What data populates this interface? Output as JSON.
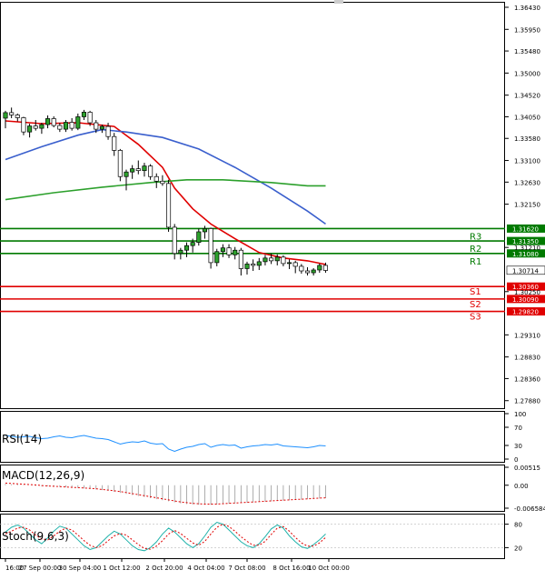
{
  "chart_data": [
    {
      "type": "candlestick",
      "ylim": [
        1.27835,
        1.3643
      ],
      "y_ticks": [
        "1.36430",
        "1.35950",
        "1.35480",
        "1.35000",
        "1.34520",
        "1.34050",
        "1.33580",
        "1.33100",
        "1.32630",
        "1.32150",
        "1.31210",
        "1.30250",
        "1.29310",
        "1.28830",
        "1.28360",
        "1.27880"
      ],
      "x_ticks": [
        "16:00",
        "27 Sep 00:00",
        "30 Sep 04:00",
        "1 Oct 12:00",
        "2 Oct 20:00",
        "4 Oct 04:00",
        "7 Oct 08:00",
        "8 Oct 16:00",
        "10 Oct 00:00"
      ],
      "current_price": {
        "value": 1.30714,
        "label": "1.30714"
      },
      "levels": [
        {
          "name": "R3",
          "value": 1.3162,
          "label": "1.31620",
          "color": "#007a00"
        },
        {
          "name": "R2",
          "value": 1.3135,
          "label": "1.31350",
          "color": "#007a00"
        },
        {
          "name": "R1",
          "value": 1.3108,
          "label": "1.31080",
          "color": "#007a00"
        },
        {
          "name": "S1",
          "value": 1.3036,
          "label": "1.30360",
          "color": "#e00000"
        },
        {
          "name": "S2",
          "value": 1.3009,
          "label": "1.30090",
          "color": "#e00000"
        },
        {
          "name": "S3",
          "value": 1.2982,
          "label": "1.29820",
          "color": "#e00000"
        }
      ],
      "candles": [
        [
          1.3402,
          1.3418,
          1.338,
          1.3414
        ],
        [
          1.3414,
          1.3425,
          1.3402,
          1.3409
        ],
        [
          1.3409,
          1.3412,
          1.3395,
          1.3403
        ],
        [
          1.3403,
          1.3405,
          1.3365,
          1.3372
        ],
        [
          1.3372,
          1.339,
          1.336,
          1.3385
        ],
        [
          1.3385,
          1.3398,
          1.3375,
          1.338
        ],
        [
          1.338,
          1.3392,
          1.3368,
          1.3388
        ],
        [
          1.3388,
          1.3408,
          1.338,
          1.3401
        ],
        [
          1.3401,
          1.3406,
          1.3382,
          1.3386
        ],
        [
          1.3386,
          1.3392,
          1.3372,
          1.3378
        ],
        [
          1.3378,
          1.3398,
          1.3372,
          1.3393
        ],
        [
          1.3393,
          1.3402,
          1.3375,
          1.338
        ],
        [
          1.338,
          1.3412,
          1.3376,
          1.3405
        ],
        [
          1.3405,
          1.342,
          1.3398,
          1.3415
        ],
        [
          1.3415,
          1.3418,
          1.3385,
          1.3392
        ],
        [
          1.3392,
          1.3398,
          1.337,
          1.3378
        ],
        [
          1.3378,
          1.3388,
          1.337,
          1.3384
        ],
        [
          1.3384,
          1.3392,
          1.3355,
          1.3362
        ],
        [
          1.3362,
          1.337,
          1.332,
          1.3332
        ],
        [
          1.3332,
          1.3335,
          1.3265,
          1.3275
        ],
        [
          1.3275,
          1.329,
          1.3245,
          1.3285
        ],
        [
          1.3285,
          1.33,
          1.327,
          1.3292
        ],
        [
          1.3292,
          1.331,
          1.328,
          1.3288
        ],
        [
          1.3288,
          1.3305,
          1.3275,
          1.3298
        ],
        [
          1.3298,
          1.3302,
          1.3268,
          1.3275
        ],
        [
          1.3275,
          1.3282,
          1.325,
          1.3265
        ],
        [
          1.3265,
          1.3278,
          1.3255,
          1.326
        ],
        [
          1.326,
          1.3268,
          1.3155,
          1.3165
        ],
        [
          1.3165,
          1.3172,
          1.3095,
          1.3108
        ],
        [
          1.3108,
          1.312,
          1.3095,
          1.3115
        ],
        [
          1.3115,
          1.3132,
          1.31,
          1.3125
        ],
        [
          1.3125,
          1.314,
          1.311,
          1.3132
        ],
        [
          1.3132,
          1.3162,
          1.3125,
          1.3155
        ],
        [
          1.3155,
          1.3168,
          1.314,
          1.3162
        ],
        [
          1.3162,
          1.3164,
          1.3075,
          1.3088
        ],
        [
          1.3088,
          1.3118,
          1.308,
          1.3112
        ],
        [
          1.3112,
          1.3128,
          1.31,
          1.312
        ],
        [
          1.312,
          1.3128,
          1.3098,
          1.3105
        ],
        [
          1.3105,
          1.3122,
          1.3095,
          1.3115
        ],
        [
          1.3115,
          1.312,
          1.306,
          1.3075
        ],
        [
          1.3075,
          1.309,
          1.3062,
          1.3085
        ],
        [
          1.3085,
          1.3095,
          1.307,
          1.3082
        ],
        [
          1.3082,
          1.3098,
          1.3072,
          1.309
        ],
        [
          1.309,
          1.3105,
          1.3082,
          1.3098
        ],
        [
          1.3098,
          1.3108,
          1.3085,
          1.3092
        ],
        [
          1.3092,
          1.3106,
          1.3082,
          1.31
        ],
        [
          1.31,
          1.3104,
          1.308,
          1.3086
        ],
        [
          1.3086,
          1.3095,
          1.3074,
          1.3088
        ],
        [
          1.3088,
          1.3092,
          1.3065,
          1.308
        ],
        [
          1.308,
          1.3085,
          1.3064,
          1.307
        ],
        [
          1.307,
          1.3078,
          1.306,
          1.3066
        ],
        [
          1.3066,
          1.3076,
          1.306,
          1.3072
        ],
        [
          1.3072,
          1.3086,
          1.3066,
          1.3082
        ],
        [
          1.3082,
          1.3088,
          1.3066,
          1.3071
        ]
      ],
      "moving_averages": [
        {
          "color": "#e00000",
          "points": [
            [
              0,
              1.3396
            ],
            [
              6,
              1.339
            ],
            [
              12,
              1.3392
            ],
            [
              18,
              1.3384
            ],
            [
              22,
              1.3345
            ],
            [
              26,
              1.3295
            ],
            [
              28,
              1.325
            ],
            [
              31,
              1.3205
            ],
            [
              34,
              1.3172
            ],
            [
              38,
              1.314
            ],
            [
              42,
              1.311
            ],
            [
              46,
              1.3098
            ],
            [
              50,
              1.3092
            ],
            [
              53,
              1.3084
            ]
          ]
        },
        {
          "color": "#3a5fcd",
          "points": [
            [
              0,
              1.3312
            ],
            [
              6,
              1.334
            ],
            [
              12,
              1.3365
            ],
            [
              16,
              1.3377
            ],
            [
              20,
              1.3372
            ],
            [
              26,
              1.336
            ],
            [
              32,
              1.3335
            ],
            [
              38,
              1.3295
            ],
            [
              44,
              1.325
            ],
            [
              50,
              1.32
            ],
            [
              53,
              1.3172
            ]
          ]
        },
        {
          "color": "#2ca02c",
          "points": [
            [
              0,
              1.3225
            ],
            [
              8,
              1.324
            ],
            [
              16,
              1.3252
            ],
            [
              24,
              1.3262
            ],
            [
              30,
              1.3268
            ],
            [
              36,
              1.3268
            ],
            [
              44,
              1.3262
            ],
            [
              50,
              1.3255
            ],
            [
              53,
              1.3255
            ]
          ]
        }
      ]
    },
    {
      "type": "line",
      "label": "RSI(14)",
      "ylim": [
        0,
        100
      ],
      "y_ticks": [
        "100",
        "70",
        "30",
        "0"
      ],
      "series": [
        {
          "color": "#1e90ff",
          "values": [
            52,
            50,
            48,
            49,
            50,
            47,
            45,
            46,
            49,
            51,
            48,
            47,
            50,
            52,
            49,
            46,
            45,
            43,
            38,
            33,
            36,
            38,
            37,
            40,
            35,
            33,
            34,
            22,
            17,
            22,
            26,
            28,
            32,
            34,
            26,
            30,
            32,
            30,
            31,
            24,
            27,
            29,
            30,
            32,
            31,
            33,
            29,
            28,
            27,
            26,
            25,
            27,
            30,
            29
          ]
        }
      ]
    },
    {
      "type": "bar",
      "label": "MACD(12,26,9)",
      "ylim": [
        -0.006584,
        0.00515
      ],
      "y_ticks": [
        "0.00515",
        "0.00",
        "-0.006584"
      ],
      "values": [
        0.0004,
        0.0003,
        0.0002,
        0.0001,
        0.0,
        -0.0002,
        -0.0003,
        -0.0003,
        -0.0004,
        -0.0005,
        -0.0006,
        -0.0007,
        -0.0008,
        -0.0009,
        -0.001,
        -0.0012,
        -0.0014,
        -0.0016,
        -0.0019,
        -0.0022,
        -0.0025,
        -0.0028,
        -0.0031,
        -0.0034,
        -0.0037,
        -0.004,
        -0.0043,
        -0.0046,
        -0.0049,
        -0.0052,
        -0.0054,
        -0.0055,
        -0.0056,
        -0.0056,
        -0.0056,
        -0.0055,
        -0.0054,
        -0.0053,
        -0.0052,
        -0.0051,
        -0.005,
        -0.0049,
        -0.0048,
        -0.0047,
        -0.0046,
        -0.0045,
        -0.0044,
        -0.0043,
        -0.0042,
        -0.0041,
        -0.004,
        -0.0039,
        -0.0038,
        -0.0037
      ],
      "signal": {
        "color": "#e00000",
        "values": [
          0.0006,
          0.0005,
          0.0004,
          0.0003,
          0.0002,
          0.0001,
          -0.0001,
          -0.0002,
          -0.0003,
          -0.0004,
          -0.0005,
          -0.0006,
          -0.0007,
          -0.0008,
          -0.0009,
          -0.001,
          -0.0012,
          -0.0014,
          -0.0016,
          -0.0018,
          -0.0021,
          -0.0024,
          -0.0027,
          -0.003,
          -0.0033,
          -0.0036,
          -0.0039,
          -0.0042,
          -0.0045,
          -0.0048,
          -0.005,
          -0.0052,
          -0.0053,
          -0.0054,
          -0.0054,
          -0.0054,
          -0.0053,
          -0.0052,
          -0.0051,
          -0.005,
          -0.0049,
          -0.0048,
          -0.0047,
          -0.0046,
          -0.0045,
          -0.0044,
          -0.0043,
          -0.0042,
          -0.0041,
          -0.004,
          -0.0039,
          -0.0038,
          -0.0037,
          -0.0036
        ]
      }
    },
    {
      "type": "line",
      "label": "Stoch(9,6,3)",
      "ylim": [
        0,
        100
      ],
      "y_ticks": [
        "80",
        "20"
      ],
      "series": [
        {
          "color": "#20b2aa",
          "values": [
            60,
            72,
            78,
            70,
            55,
            40,
            30,
            45,
            62,
            75,
            70,
            55,
            40,
            25,
            15,
            20,
            35,
            50,
            62,
            55,
            40,
            25,
            15,
            12,
            20,
            35,
            55,
            70,
            60,
            45,
            30,
            20,
            30,
            50,
            72,
            85,
            80,
            65,
            50,
            35,
            25,
            20,
            30,
            48,
            68,
            78,
            70,
            50,
            35,
            22,
            18,
            28,
            40,
            55
          ]
        },
        {
          "color": "#e00000",
          "values": [
            55,
            62,
            70,
            72,
            65,
            52,
            42,
            40,
            50,
            62,
            70,
            65,
            52,
            38,
            26,
            20,
            25,
            38,
            50,
            56,
            52,
            40,
            28,
            18,
            16,
            24,
            38,
            55,
            64,
            56,
            44,
            32,
            26,
            36,
            55,
            72,
            80,
            74,
            62,
            48,
            36,
            26,
            26,
            36,
            54,
            70,
            74,
            62,
            46,
            32,
            24,
            24,
            32,
            46
          ]
        }
      ]
    }
  ]
}
